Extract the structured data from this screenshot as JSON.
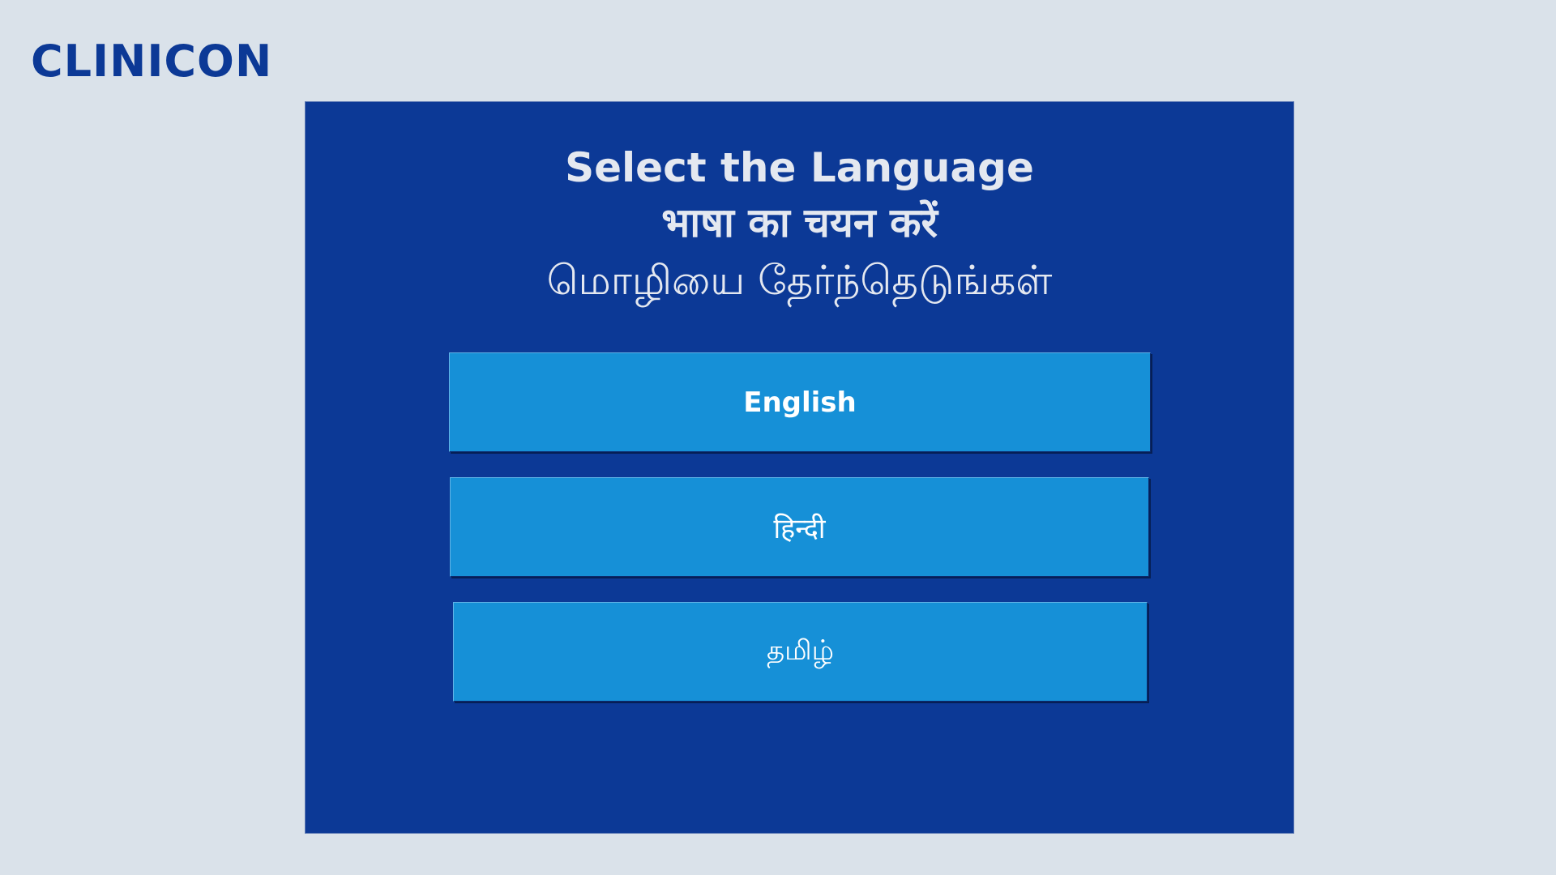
{
  "app": {
    "logo_text": "CLINICON"
  },
  "language_selector": {
    "heading_lines": [
      "Select the Language",
      "भाषा का चयन करें",
      "மொழியை தேர்ந்தெடுங்கள்"
    ],
    "options": [
      {
        "label": "English"
      },
      {
        "label": "हिन्दी"
      },
      {
        "label": "தமிழ்"
      }
    ]
  },
  "colors": {
    "background": "#dae2ea",
    "panel": "#0c3996",
    "button": "#1690d7",
    "logo": "#0c3996",
    "heading_text": "#e4e8f0",
    "button_text": "#ffffff"
  }
}
